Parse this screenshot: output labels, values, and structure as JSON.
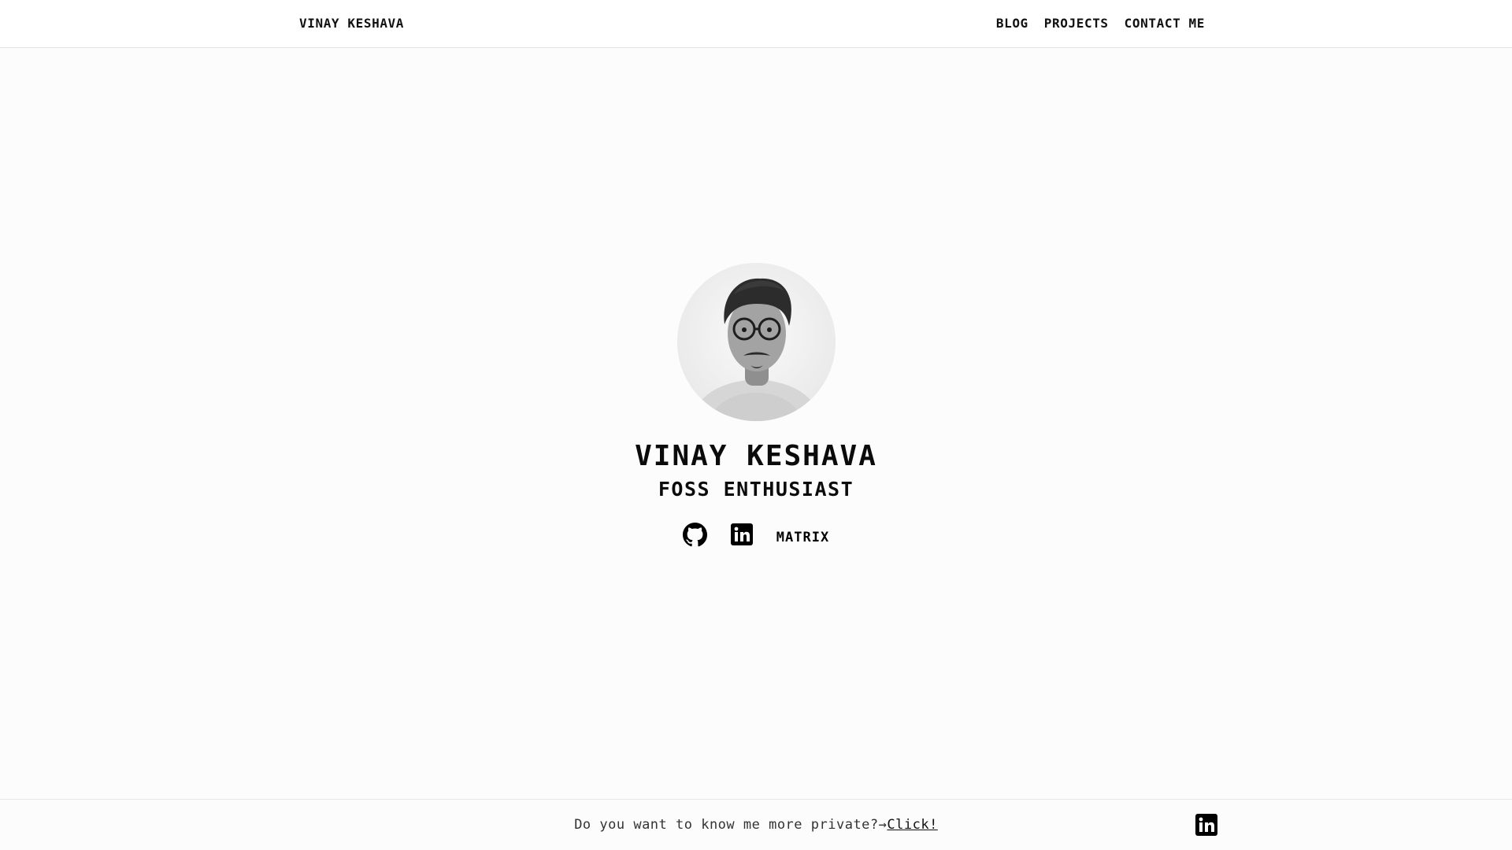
{
  "header": {
    "brand": "VINAY KESHAVA",
    "nav": [
      {
        "label": "BLOG"
      },
      {
        "label": "PROJECTS"
      },
      {
        "label": "CONTACT ME"
      }
    ]
  },
  "hero": {
    "name": "VINAY KESHAVA",
    "role": "FOSS ENTHUSIAST",
    "avatar_icon": "profile-photo",
    "socials": [
      {
        "icon": "github-icon"
      },
      {
        "icon": "linkedin-icon"
      },
      {
        "label": "MATRIX"
      }
    ]
  },
  "footer": {
    "question": "Do you want to know me more private?→",
    "link_label": "Click!",
    "icon": "linkedin-icon"
  },
  "colors": {
    "background": "#fcfcfc",
    "text": "#111111",
    "border": "#e2e2e2"
  }
}
